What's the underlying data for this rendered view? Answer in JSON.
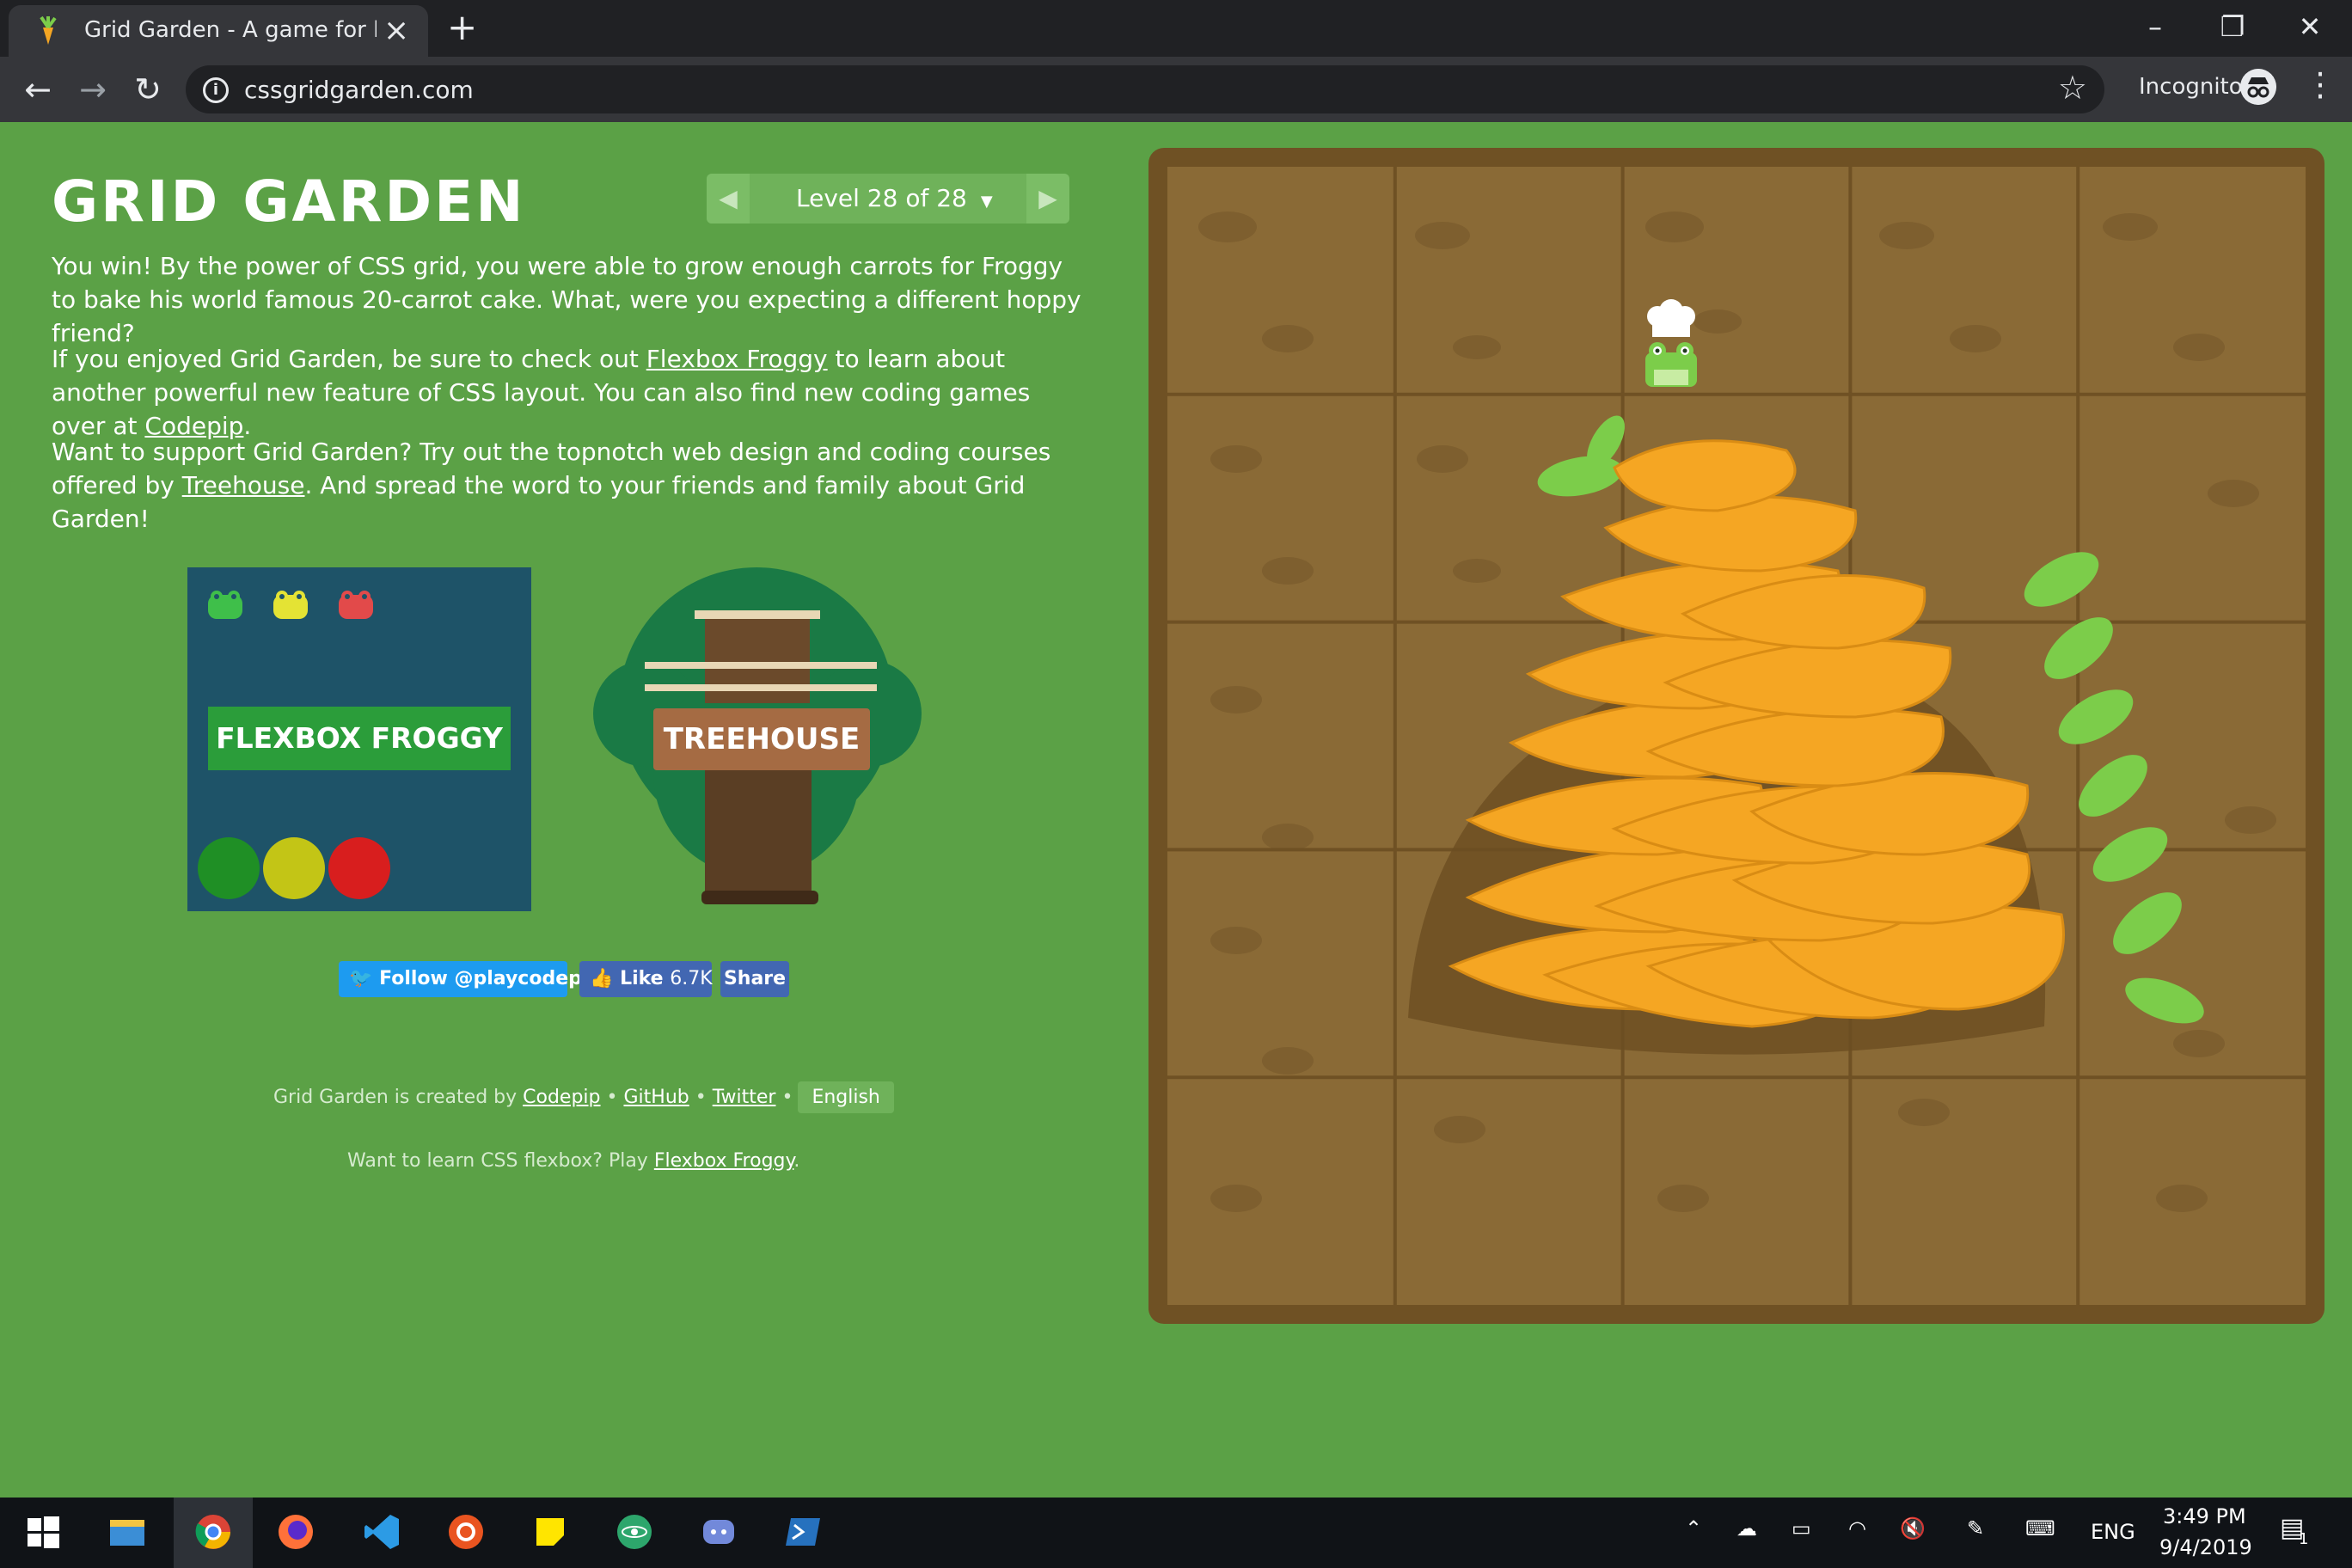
{
  "browser": {
    "tab_title": "Grid Garden - A game for learning CSS grid",
    "url": "cssgridgarden.com",
    "incognito_label": "Incognito",
    "icons": {
      "back": "back-arrow-icon",
      "forward": "forward-arrow-icon",
      "reload": "reload-icon",
      "bookmark": "star-icon"
    }
  },
  "page": {
    "title": "GRID GARDEN",
    "level": {
      "label": "Level 28 of 28",
      "current": 28,
      "total": 28
    },
    "para1": "You win! By the power of CSS grid, you were able to grow enough carrots for Froggy to bake his world famous 20-carrot cake. What, were you expecting a different hoppy friend?",
    "para2": {
      "before": "If you enjoyed Grid Garden, be sure to check out ",
      "link1": "Flexbox Froggy",
      "middle": " to learn about another powerful new feature of CSS layout. You can also find new coding games over at ",
      "link2": "Codepip",
      "after": "."
    },
    "para3": {
      "before": "Want to support Grid Garden? Try out the topnotch web design and coding courses offered by ",
      "link": "Treehouse",
      "after": ". And spread the word to your friends and family about Grid Garden!"
    },
    "promo": {
      "froggy_label": "FLEXBOX FROGGY",
      "treehouse_label": "TREEHOUSE"
    },
    "social": {
      "twitter": "Follow @playcodepip",
      "like": "Like",
      "like_count": "6.7K",
      "share": "Share"
    },
    "footer": {
      "created_by": "Grid Garden is created by ",
      "codepip": "Codepip",
      "github": "GitHub",
      "twitter": "Twitter",
      "sep": "•",
      "language": "English",
      "flexbox_prompt": "Want to learn CSS flexbox? Play ",
      "flexbox_link": "Flexbox Froggy",
      "flexbox_end": "."
    }
  },
  "colors": {
    "page_bg": "#5ba146",
    "garden_frame": "#6f5124",
    "garden_soil": "#8a6a36",
    "carrot": "#f5a623",
    "carrot_top": "#7ccd4a",
    "froggy_card": "#1e5368"
  },
  "taskbar": {
    "apps": [
      "windows-start-icon",
      "file-explorer-icon",
      "chrome-icon",
      "firefox-icon",
      "vscode-icon",
      "ubuntu-icon",
      "sticky-notes-icon",
      "atom-icon",
      "discord-icon",
      "powershell-icon"
    ],
    "language": "ENG",
    "time": "3:49 PM",
    "date": "9/4/2019",
    "notifications": "1"
  }
}
